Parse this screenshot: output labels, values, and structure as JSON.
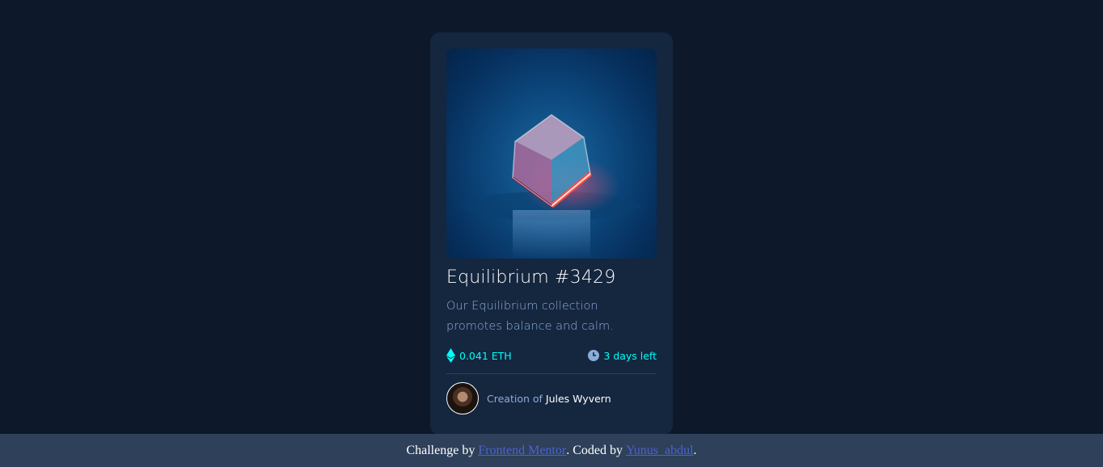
{
  "card": {
    "image_alt": "equilibrium-cube-image",
    "title": "Equilibrium #3429",
    "description": "Our Equilibrium collection promotes balance and calm.",
    "price": "0.041 ETH",
    "price_icon": "ethereum-icon",
    "time_left": "3 days left",
    "time_icon": "clock-icon",
    "creator_prefix": "Creation of",
    "creator_name": "Jules Wyvern"
  },
  "footer": {
    "text_before": "Challenge by ",
    "link1": "Frontend Mentor",
    "text_middle": ". Coded by ",
    "link2": "Yunus_abdul",
    "text_after": "."
  },
  "colors": {
    "page_bg": "#0d192b",
    "card_bg": "#15263f",
    "accent": "#00fff8",
    "muted": "#8bacd9",
    "footer_bg": "#2e405a",
    "link": "#4b62cf"
  }
}
